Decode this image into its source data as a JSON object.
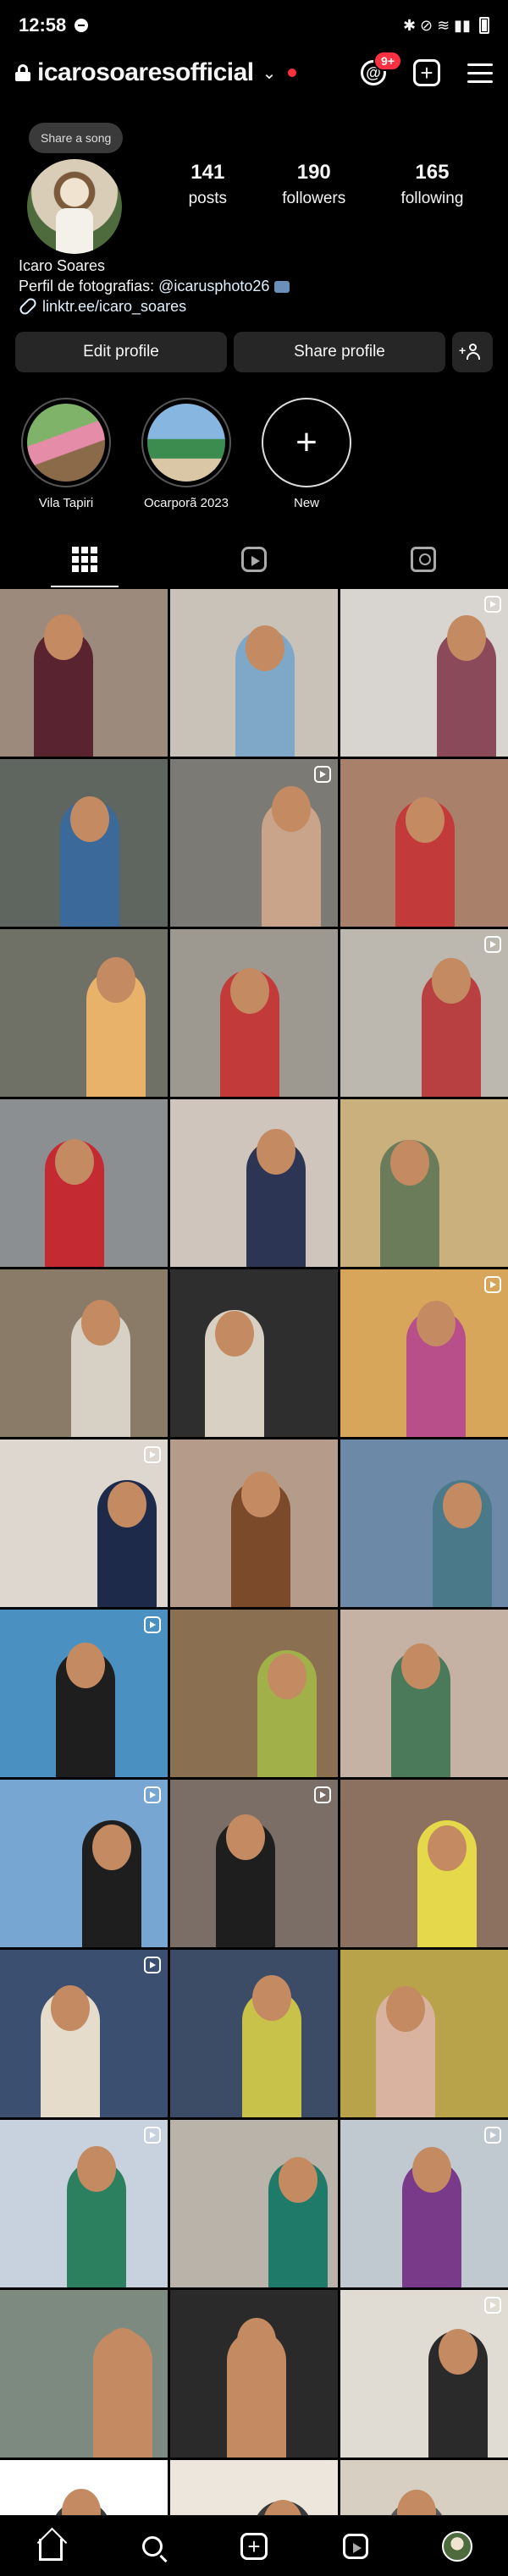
{
  "status_bar": {
    "time": "12:58",
    "icons_text": "✱ ⊘ ≋ ▮▮"
  },
  "header": {
    "username": "icarosoaresofficial",
    "notification_badge": "9+"
  },
  "profile": {
    "song_prompt": "Share a song",
    "stats": [
      {
        "value": "141",
        "label": "posts"
      },
      {
        "value": "190",
        "label": "followers"
      },
      {
        "value": "165",
        "label": "following"
      }
    ],
    "name": "Icaro Soares",
    "bio_prefix": "Perfil de fotografias: ",
    "bio_handle": "@icarusphoto26",
    "link": "linktr.ee/icaro_soares"
  },
  "actions": {
    "edit_profile": "Edit profile",
    "share_profile": "Share profile"
  },
  "highlights": [
    {
      "label": "Vila Tapiri"
    },
    {
      "label": "Ocarporã 2023"
    },
    {
      "label": "New",
      "glyph": "+"
    }
  ],
  "grid_tiles": [
    {
      "bg": "#9c8a7c",
      "accent": "#5a2330",
      "reel": false
    },
    {
      "bg": "#c9c2b8",
      "accent": "#7fa8c8",
      "reel": false
    },
    {
      "bg": "#d8d4cf",
      "accent": "#8a4a5a",
      "reel": true
    },
    {
      "bg": "#5f6660",
      "accent": "#3b6a9a",
      "reel": false
    },
    {
      "bg": "#7c7a74",
      "accent": "#c9a38a",
      "reel": true
    },
    {
      "bg": "#a9806a",
      "accent": "#c23a3a",
      "reel": false
    },
    {
      "bg": "#6f7066",
      "accent": "#e8b26a",
      "reel": false
    },
    {
      "bg": "#9d9890",
      "accent": "#c23a3a",
      "reel": false
    },
    {
      "bg": "#bcb8b0",
      "accent": "#b84040",
      "reel": true
    },
    {
      "bg": "#8b8f92",
      "accent": "#c42a32",
      "reel": false
    },
    {
      "bg": "#cfc5bc",
      "accent": "#2d3555",
      "reel": false
    },
    {
      "bg": "#c9b07c",
      "accent": "#6b7c5a",
      "reel": false
    },
    {
      "bg": "#8a7a68",
      "accent": "#d7d0c4",
      "reel": false
    },
    {
      "bg": "#2e2e2e",
      "accent": "#d9d0c4",
      "reel": false
    },
    {
      "bg": "#d8a65a",
      "accent": "#b84f8a",
      "reel": true
    },
    {
      "bg": "#ddd7cf",
      "accent": "#1e2a4a",
      "reel": true
    },
    {
      "bg": "#b59b8a",
      "accent": "#7a4a2a",
      "reel": false
    },
    {
      "bg": "#6c8aa8",
      "accent": "#4a7a8a",
      "reel": false
    },
    {
      "bg": "#4a90c0",
      "accent": "#1e1e1e",
      "reel": true
    },
    {
      "bg": "#8a7050",
      "accent": "#a2b04a",
      "reel": false
    },
    {
      "bg": "#c5b2a4",
      "accent": "#4a7a5a",
      "reel": false
    },
    {
      "bg": "#77a6d2",
      "accent": "#1e1e1e",
      "reel": true
    },
    {
      "bg": "#7a6e66",
      "accent": "#1e1e1e",
      "reel": true
    },
    {
      "bg": "#8c7060",
      "accent": "#e5d84a",
      "reel": false
    },
    {
      "bg": "#3b5070",
      "accent": "#e6dccb",
      "reel": true
    },
    {
      "bg": "#3d4c66",
      "accent": "#c9c24a",
      "reel": false
    },
    {
      "bg": "#b8a24a",
      "accent": "#d9b2a0",
      "reel": false
    },
    {
      "bg": "#c7d2de",
      "accent": "#2c8060",
      "reel": true
    },
    {
      "bg": "#b9b3aa",
      "accent": "#1f7a6a",
      "reel": false
    },
    {
      "bg": "#c0c8d0",
      "accent": "#7a3a8a",
      "reel": true
    },
    {
      "bg": "#7c8a80",
      "accent": "#c48a62",
      "reel": false
    },
    {
      "bg": "#2a2a2a",
      "accent": "#c48a62",
      "reel": false
    },
    {
      "bg": "#e0dcd4",
      "accent": "#2a2a2a",
      "reel": true
    },
    {
      "bg": "#ffffff",
      "accent": "#3a3a3a",
      "reel": false
    },
    {
      "bg": "#ece6dc",
      "accent": "#3a3a3a",
      "reel": false
    },
    {
      "bg": "#d7cfc2",
      "accent": "#5a5a5a",
      "reel": false
    }
  ]
}
